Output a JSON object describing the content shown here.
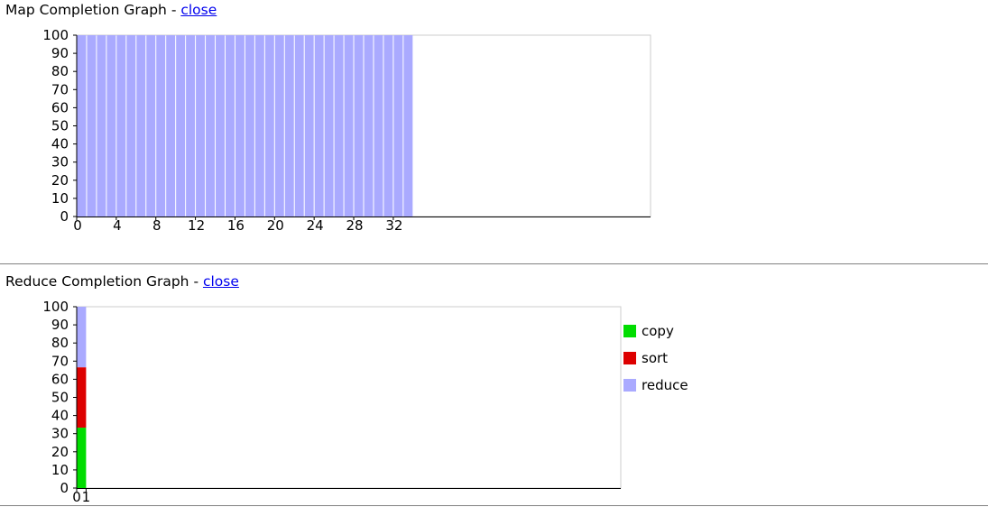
{
  "map_section": {
    "title": "Map Completion Graph",
    "separator": " - ",
    "close_label": "close"
  },
  "reduce_section": {
    "title": "Reduce Completion Graph",
    "separator": " - ",
    "close_label": "close"
  },
  "colors": {
    "map": "#aaaaff",
    "copy": "#00dd00",
    "sort": "#dd0000",
    "reduce": "#aaaaff",
    "axis": "#000000",
    "frame": "#cccccc"
  },
  "chart_data": [
    {
      "type": "bar",
      "ylim": [
        0,
        100
      ],
      "yticks": [
        "0",
        "10",
        "20",
        "30",
        "40",
        "50",
        "60",
        "70",
        "80",
        "90",
        "100"
      ],
      "xtick_labels": [
        "0",
        "4",
        "8",
        "12",
        "16",
        "20",
        "24",
        "28",
        "32"
      ],
      "xtick_positions": [
        0,
        4,
        8,
        12,
        16,
        20,
        24,
        28,
        32
      ],
      "x_slots": 58,
      "series": [
        {
          "values": [
            100,
            100,
            100,
            100,
            100,
            100,
            100,
            100,
            100,
            100,
            100,
            100,
            100,
            100,
            100,
            100,
            100,
            100,
            100,
            100,
            100,
            100,
            100,
            100,
            100,
            100,
            100,
            100,
            100,
            100,
            100,
            100,
            100,
            100
          ]
        }
      ]
    },
    {
      "type": "bar",
      "stacked": true,
      "ylim": [
        0,
        100
      ],
      "yticks": [
        "0",
        "10",
        "20",
        "30",
        "40",
        "50",
        "60",
        "70",
        "80",
        "90",
        "100"
      ],
      "xtick_labels": [
        "0",
        "1"
      ],
      "xtick_positions": [
        0,
        1
      ],
      "x_slots": 58,
      "categories": [
        "0"
      ],
      "series": [
        {
          "name": "copy",
          "values": [
            33.3
          ]
        },
        {
          "name": "sort",
          "values": [
            33.3
          ]
        },
        {
          "name": "reduce",
          "values": [
            33.4
          ]
        }
      ],
      "legend": [
        "copy",
        "sort",
        "reduce"
      ],
      "legend_position": "right"
    }
  ]
}
